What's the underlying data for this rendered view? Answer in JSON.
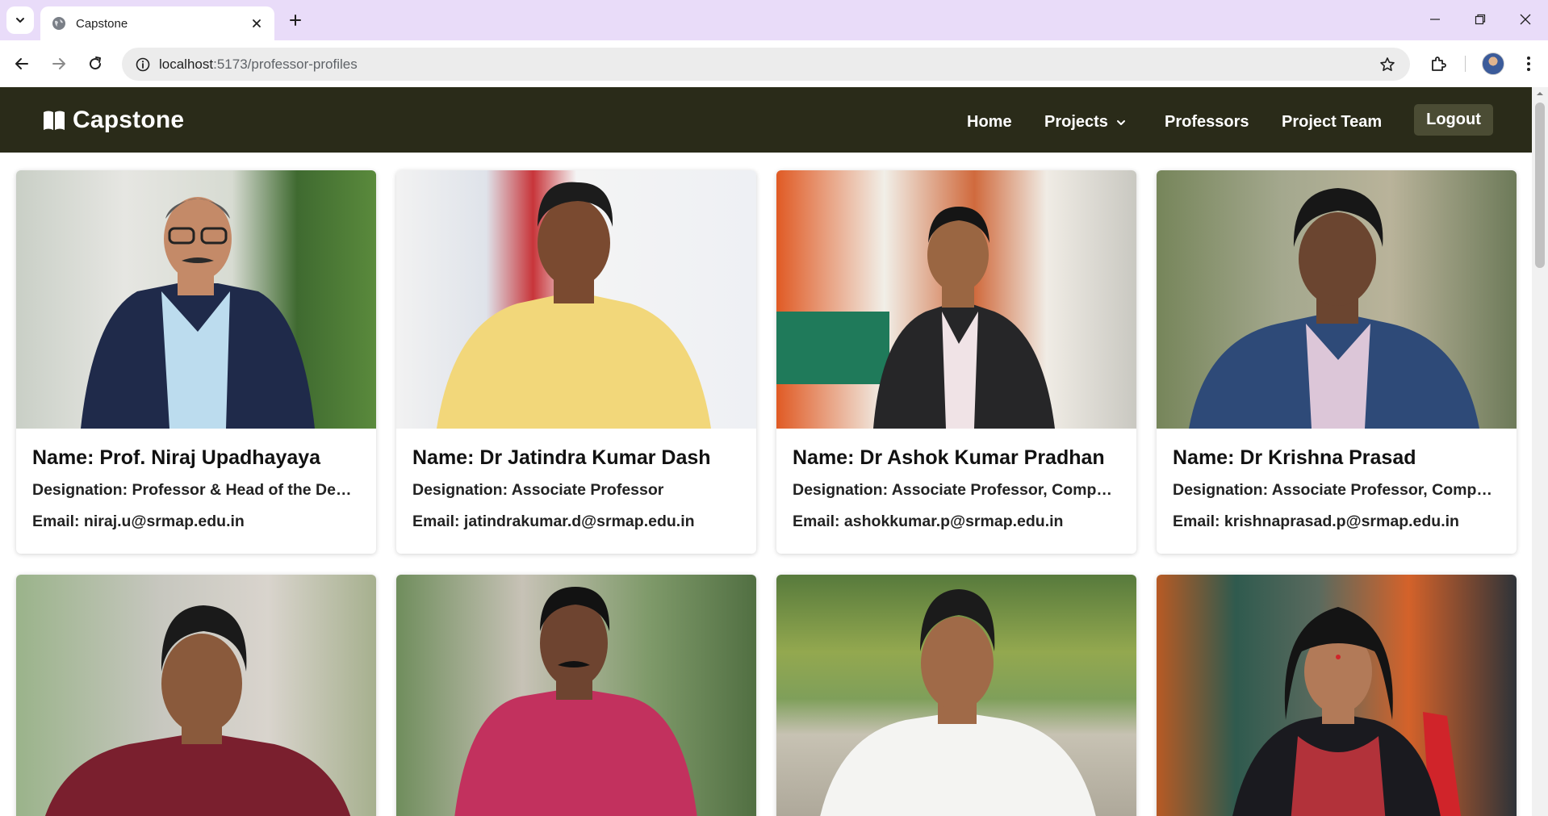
{
  "browser": {
    "tab_title": "Capstone",
    "url_host": "localhost",
    "url_path": ":5173/professor-profiles"
  },
  "app": {
    "brand": "Capstone",
    "nav": {
      "home": "Home",
      "projects": "Projects",
      "professors": "Professors",
      "project_team": "Project Team",
      "logout": "Logout"
    }
  },
  "professors": [
    {
      "name": "Name: Prof. Niraj Upadhayaya",
      "designation": "Designation: Professor & Head of the Department",
      "email": "Email: niraj.u@srmap.edu.in"
    },
    {
      "name": "Name: Dr Jatindra Kumar Dash",
      "designation": "Designation: Associate Professor",
      "email": "Email: jatindrakumar.d@srmap.edu.in"
    },
    {
      "name": "Name: Dr Ashok Kumar Pradhan",
      "designation": "Designation: Associate Professor, Computer Science",
      "email": "Email: ashokkumar.p@srmap.edu.in"
    },
    {
      "name": "Name: Dr Krishna Prasad",
      "designation": "Designation: Associate Professor, Computer Science",
      "email": "Email: krishnaprasad.p@srmap.edu.in"
    }
  ],
  "icons": {
    "tab_search": "chevron-down-icon",
    "favicon": "globe-icon",
    "tab_close": "close-icon",
    "new_tab": "plus-icon",
    "back": "arrow-left-icon",
    "forward": "arrow-right-icon",
    "reload": "reload-icon",
    "site_info": "info-icon",
    "bookmark": "star-icon",
    "extensions": "puzzle-icon",
    "menu": "kebab-icon",
    "brand": "book-icon"
  },
  "colors": {
    "tabstrip": "#e9dcf9",
    "navbar": "#2a2b19",
    "logout_bg": "#4b4c34"
  }
}
